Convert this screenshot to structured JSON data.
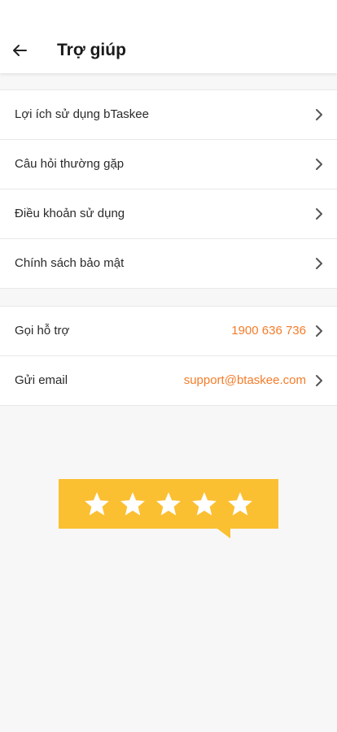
{
  "header": {
    "title": "Trợ giúp",
    "back_icon": "arrow-left-icon"
  },
  "menu": {
    "items": [
      {
        "label": "Lợi ích sử dụng bTaskee"
      },
      {
        "label": "Câu hỏi thường gặp"
      },
      {
        "label": "Điều khoản sử dụng"
      },
      {
        "label": "Chính sách bảo mật"
      }
    ]
  },
  "contact": {
    "items": [
      {
        "label": "Gọi hỗ trợ",
        "value": "1900 636 736"
      },
      {
        "label": "Gửi email",
        "value": "support@btaskee.com"
      }
    ]
  },
  "rating": {
    "stars": 5,
    "color": "#fbbf32"
  },
  "colors": {
    "accent": "#f57c2a",
    "background": "#f7f7f7"
  }
}
